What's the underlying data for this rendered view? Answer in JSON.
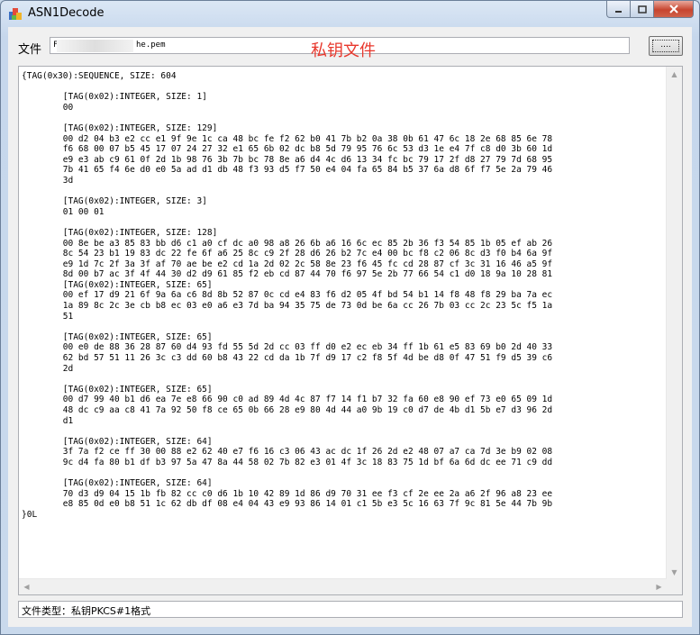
{
  "window": {
    "title": "ASN1Decode",
    "accent": "#e8382d"
  },
  "file": {
    "label": "文件",
    "path_prefix": "F",
    "path_suffix": "he.pem",
    "browse_label": "...."
  },
  "overlay": {
    "title": "私钥文件"
  },
  "decoded_text": "{TAG(0x30):SEQUENCE, SIZE: 604\n\n        [TAG(0x02):INTEGER, SIZE: 1]\n        00\n\n        [TAG(0x02):INTEGER, SIZE: 129]\n        00 d2 04 b3 e2 cc e1 9f 9e 1c ca 48 bc fe f2 62 b0 41 7b b2 0a 38 0b 61 47 6c 18 2e 68 85 6e 78\n        f6 68 00 07 b5 45 17 07 24 27 32 e1 65 6b 02 dc b8 5d 79 95 76 6c 53 d3 1e e4 7f c8 d0 3b 60 1d\n        e9 e3 ab c9 61 0f 2d 1b 98 76 3b 7b bc 78 8e a6 d4 4c d6 13 34 fc bc 79 17 2f d8 27 79 7d 68 95\n        7b 41 65 f4 6e d0 e0 5a ad d1 db 48 f3 93 d5 f7 50 e4 04 fa 65 84 b5 37 6a d8 6f f7 5e 2a 79 46\n        3d\n\n        [TAG(0x02):INTEGER, SIZE: 3]\n        01 00 01\n\n        [TAG(0x02):INTEGER, SIZE: 128]\n        00 8e be a3 85 83 bb d6 c1 a0 cf dc a0 98 a8 26 6b a6 16 6c ec 85 2b 36 f3 54 85 1b 05 ef ab 26\n        8c 54 23 b1 19 83 dc 22 fe 6f a6 25 8c c9 2f 28 d6 26 b2 7c e4 00 bc f8 c2 06 8c d3 f0 b4 6a 9f\n        e9 1d 7c 2f 3a 3f af 70 ae be e2 cd 1a 2d 02 2c 58 8e 23 f6 45 fc cd 28 87 cf 3c 31 16 46 a5 9f\n        8d 00 b7 ac 3f 4f 44 30 d2 d9 61 85 f2 eb cd 87 44 70 f6 97 5e 2b 77 66 54 c1 d0 18 9a 10 28 81\n        [TAG(0x02):INTEGER, SIZE: 65]\n        00 ef 17 d9 21 6f 9a 6a c6 8d 8b 52 87 0c cd e4 83 f6 d2 05 4f bd 54 b1 14 f8 48 f8 29 ba 7a ec\n        1a 89 8c 2c 3e cb b8 ec 03 e0 a6 e3 7d ba 94 35 75 de 73 0d be 6a cc 26 7b 03 cc 2c 23 5c f5 1a\n        51\n\n        [TAG(0x02):INTEGER, SIZE: 65]\n        00 e0 de 88 36 28 87 60 d4 93 fd 55 5d 2d cc 03 ff d0 e2 ec eb 34 ff 1b 61 e5 83 69 b0 2d 40 33\n        62 bd 57 51 11 26 3c c3 dd 60 b8 43 22 cd da 1b 7f d9 17 c2 f8 5f 4d be d8 0f 47 51 f9 d5 39 c6\n        2d\n\n        [TAG(0x02):INTEGER, SIZE: 65]\n        00 d7 99 40 b1 d6 ea 7e e8 66 90 c0 ad 89 4d 4c 87 f7 14 f1 b7 32 fa 60 e8 90 ef 73 e0 65 09 1d\n        48 dc c9 aa c8 41 7a 92 50 f8 ce 65 0b 66 28 e9 80 4d 44 a0 9b 19 c0 d7 de 4b d1 5b e7 d3 96 2d\n        d1\n\n        [TAG(0x02):INTEGER, SIZE: 64]\n        3f 7a f2 ce ff 30 00 88 e2 62 40 e7 f6 16 c3 06 43 ac dc 1f 26 2d e2 48 07 a7 ca 7d 3e b9 02 08\n        9c d4 fa 80 b1 df b3 97 5a 47 8a 44 58 02 7b 82 e3 01 4f 3c 18 83 75 1d bf 6a 6d dc ee 71 c9 dd\n\n        [TAG(0x02):INTEGER, SIZE: 64]\n        70 d3 d9 04 15 1b fb 82 cc c0 d6 1b 10 42 89 1d 86 d9 70 31 ee f3 cf 2e ee 2a a6 2f 96 a8 23 ee\n        e8 85 0d e0 b8 51 1c 62 db df 08 e4 04 43 e9 93 86 14 01 c1 5b e3 5c 16 63 7f 9c 81 5e 44 7b 9b\n}0L",
  "status": {
    "text": "文件类型：私钥PKCS#1格式"
  }
}
